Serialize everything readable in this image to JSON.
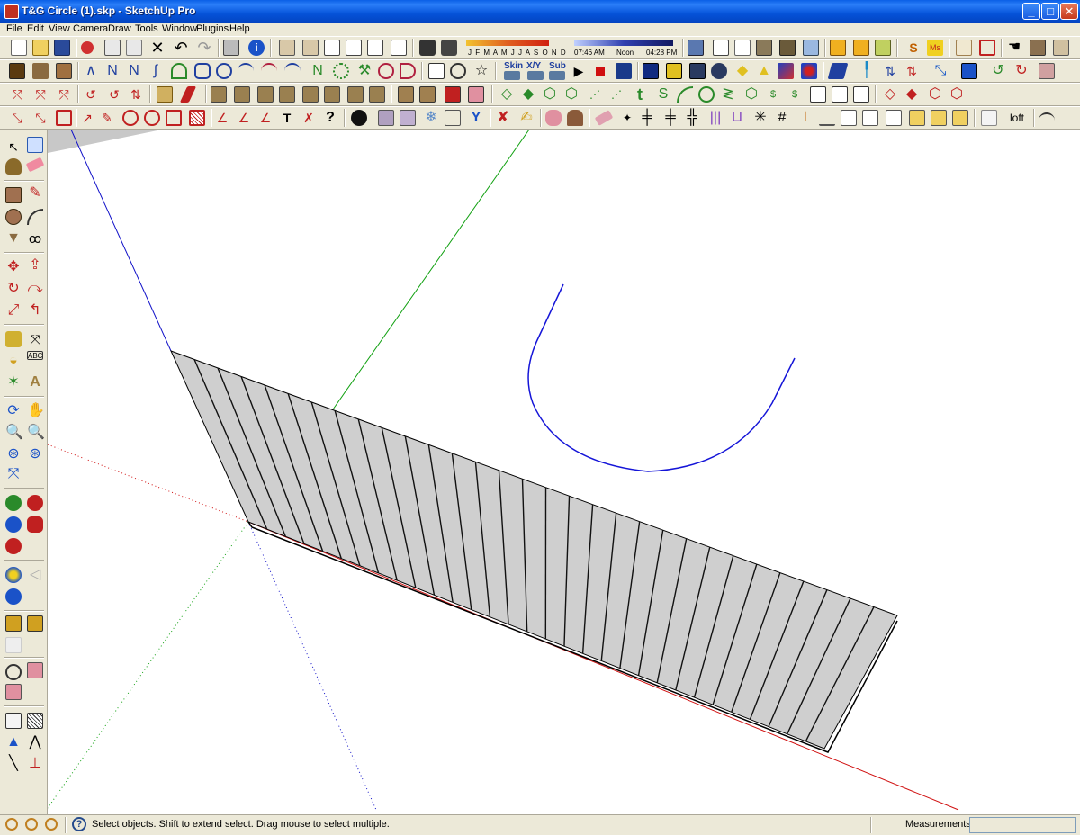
{
  "window": {
    "title": "T&G Circle (1).skp - SketchUp Pro",
    "minimize": "_",
    "maximize": "□",
    "close": "✕"
  },
  "menu": [
    "File",
    "Edit",
    "View",
    "Camera",
    "Draw",
    "Tools",
    "Window",
    "Plugins",
    "Help"
  ],
  "toolbar": {
    "shadow_months": "J F M A M J J A S O N D",
    "time_start": "07:46 AM",
    "time_noon": "Noon",
    "time_end": "04:28 PM",
    "skin_label": "Skin",
    "xyz_label": "X/Y",
    "sub_label": "Sub",
    "text_tool": "t",
    "loft_label": "loft",
    "help_glyph": "?"
  },
  "status": {
    "text": "Select objects. Shift to extend select. Drag mouse to select multiple.",
    "measurements_label": "Measurements",
    "measurements_value": ""
  },
  "colors": {
    "title_bar": "#0a5fe6",
    "red_axis": "#d01010",
    "green_axis": "#10a010",
    "blue_axis": "#1010c8",
    "panel_face": "#cfcfcf",
    "curve": "#1515d8",
    "chrome": "#ece9d8"
  },
  "icons": {
    "top_row_1": [
      "new-icon",
      "open-icon",
      "save-icon",
      "cut-icon",
      "copy-icon",
      "paste-icon",
      "erase-icon",
      "undo-icon",
      "redo-icon",
      "print-icon",
      "model-info-icon",
      "iso-view-icon",
      "top-view-icon",
      "front-view-icon",
      "right-view-icon",
      "back-view-icon",
      "left-view-icon",
      "display-shadows-icon",
      "display-fog-icon"
    ],
    "left_tools": [
      "select-icon",
      "make-component-icon",
      "paint-bucket-icon",
      "eraser-icon",
      "rectangle-icon",
      "line-icon",
      "circle-icon",
      "arc-icon",
      "polygon-icon",
      "freehand-icon",
      "move-icon",
      "push-pull-icon",
      "rotate-icon",
      "follow-me-icon",
      "scale-icon",
      "offset-icon",
      "tape-measure-icon",
      "dimension-icon",
      "protractor-icon",
      "text-icon",
      "axes-icon",
      "3d-text-icon",
      "orbit-icon",
      "pan-icon",
      "zoom-icon",
      "zoom-window-icon",
      "previous-view-icon",
      "next-view-icon",
      "zoom-extents-icon"
    ]
  }
}
